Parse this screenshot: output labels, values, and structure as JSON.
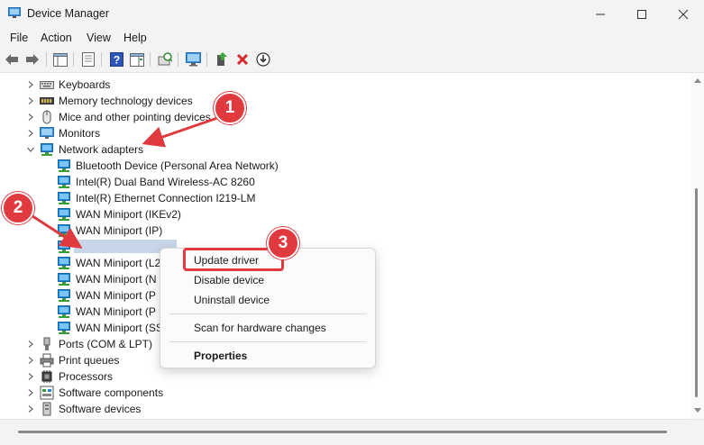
{
  "window": {
    "title": "Device Manager"
  },
  "menu": [
    "File",
    "Action",
    "View",
    "Help"
  ],
  "tree": [
    {
      "label": "Keyboards",
      "icon": "keyboard-icon"
    },
    {
      "label": "Memory technology devices",
      "icon": "memory-icon"
    },
    {
      "label": "Mice and other pointing devices",
      "icon": "mouse-icon"
    },
    {
      "label": "Monitors",
      "icon": "monitor-icon"
    },
    {
      "label": "Network adapters",
      "icon": "network-adapter-icon"
    },
    {
      "label": "Bluetooth Device (Personal Area Network)",
      "icon": "network-adapter-icon"
    },
    {
      "label": "Intel(R) Dual Band Wireless-AC 8260",
      "icon": "network-adapter-icon"
    },
    {
      "label": "Intel(R) Ethernet Connection I219-LM",
      "icon": "network-adapter-icon"
    },
    {
      "label": "WAN Miniport (IKEv2)",
      "icon": "network-adapter-icon"
    },
    {
      "label": "WAN Miniport (IP)",
      "icon": "network-adapter-icon"
    },
    {
      "label": "",
      "icon": "network-adapter-icon"
    },
    {
      "label": "WAN Miniport (L2",
      "icon": "network-adapter-icon"
    },
    {
      "label": "WAN Miniport (N",
      "icon": "network-adapter-icon"
    },
    {
      "label": "WAN Miniport (P",
      "icon": "network-adapter-icon"
    },
    {
      "label": "WAN Miniport (P",
      "icon": "network-adapter-icon"
    },
    {
      "label": "WAN Miniport (SS",
      "icon": "network-adapter-icon"
    },
    {
      "label": "Ports (COM & LPT)",
      "icon": "port-icon"
    },
    {
      "label": "Print queues",
      "icon": "printer-icon"
    },
    {
      "label": "Processors",
      "icon": "processor-icon"
    },
    {
      "label": "Software components",
      "icon": "software-component-icon"
    },
    {
      "label": "Software devices",
      "icon": "software-device-icon"
    }
  ],
  "context_menu": {
    "update": "Update driver",
    "disable": "Disable device",
    "uninstall": "Uninstall device",
    "scan": "Scan for hardware changes",
    "properties": "Properties"
  },
  "callouts": [
    "1",
    "2",
    "3"
  ],
  "colors": {
    "accent": "#e0393e",
    "selection": "#c7d6e8",
    "network_icon": "#1e88d6"
  }
}
